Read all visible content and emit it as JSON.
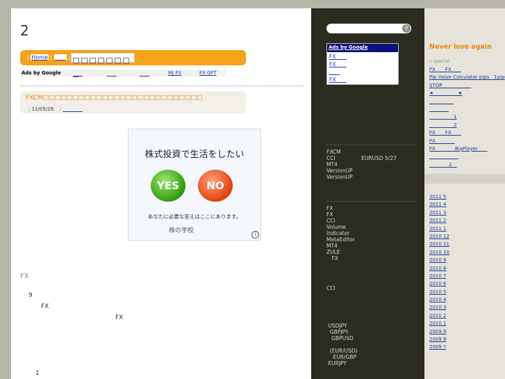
{
  "page": {
    "title": "2"
  },
  "nav": {
    "home": "Home",
    "home_link": "　　"
  },
  "ads_row": {
    "label": "Ads by Google",
    "links": [
      "　　",
      "　　",
      "　　",
      "MJ FX",
      "FX GFT"
    ]
  },
  "post": {
    "title": "FXCM□□□□□□□□□□□□□□□□□□□□□□□□□□□",
    "date": ": 11/05/29.",
    "sep": ":",
    "author": "　　　　"
  },
  "banner": {
    "question": "株式投資で生活をしたい",
    "yes": "YES",
    "no": "NO",
    "sub": "あなたに必要な答えはここにあります。",
    "logo": "株の学校",
    "info": "i"
  },
  "body": {
    "heading": "FX",
    "line1": "9",
    "line2": "FX",
    "line3": "FX",
    "line4": "1"
  },
  "sidebar_dark": {
    "ad_label": "Ads by Google",
    "ad_links": [
      "FX　　",
      "FX　　",
      "　　",
      "FX　　"
    ],
    "block1": "FXCM\nCCI　　　　　EURUSD 5/27\nMT4\nVersionUP\nVersionUP",
    "block2": "FX\nFX\nCCI\nVolume\nIndicator\nMetaEditor\nMT4\nZULE\n　FX",
    "block3": "CCI",
    "block4": " USDJPY\n  GBPJPY\n   GBPUSD\n\n  (EUR/USD)\n    EUR/GBP\n EURJPY"
  },
  "sidebar_right": {
    "title": "Never lose again",
    "special": "» special",
    "links": [
      "FX　　FX　　",
      "Pip Value Calculator pips　1pip",
      "STOP　　　　　　",
      "★　　　　　★",
      "　　　　　",
      "　　　　",
      "　　　　　1",
      "　　　　　2",
      "FX　　FX　　",
      "FX　　　　",
      "FX　　　　BigPlayer　　",
      "　　　　　　",
      "　　　　2　"
    ],
    "archives": [
      "2011 5",
      "2011 4",
      "2011 3",
      "2011 2",
      "2011 1",
      "2010 12",
      "2010 11",
      "2010 10",
      "2010 9",
      "2010 8",
      "2010 7",
      "2010 6",
      "2010 5",
      "2010 4",
      "2010 3",
      "2010 2",
      "2010 1",
      "2009 9",
      "2009 8",
      "2009 7"
    ]
  }
}
